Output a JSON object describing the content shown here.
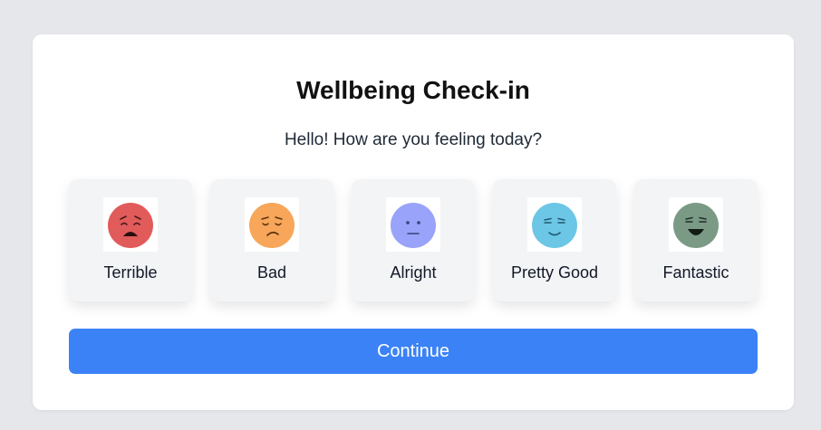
{
  "title": "Wellbeing Check-in",
  "subtitle": "Hello! How are you feeling today?",
  "moods": [
    {
      "label": "Terrible",
      "icon": "miserable-face-icon",
      "color": "#e15b5b"
    },
    {
      "label": "Bad",
      "icon": "disappointed-face-icon",
      "color": "#f7a65a"
    },
    {
      "label": "Alright",
      "icon": "neutral-face-icon",
      "color": "#99a3f9"
    },
    {
      "label": "Pretty Good",
      "icon": "content-face-icon",
      "color": "#6cc6e6"
    },
    {
      "label": "Fantastic",
      "icon": "grinning-face-icon",
      "color": "#7a9a86"
    }
  ],
  "continue_label": "Continue",
  "colors": {
    "page_background": "#e5e7eb",
    "card_background": "#ffffff",
    "option_background": "#f3f4f6",
    "accent": "#3b82f6"
  }
}
